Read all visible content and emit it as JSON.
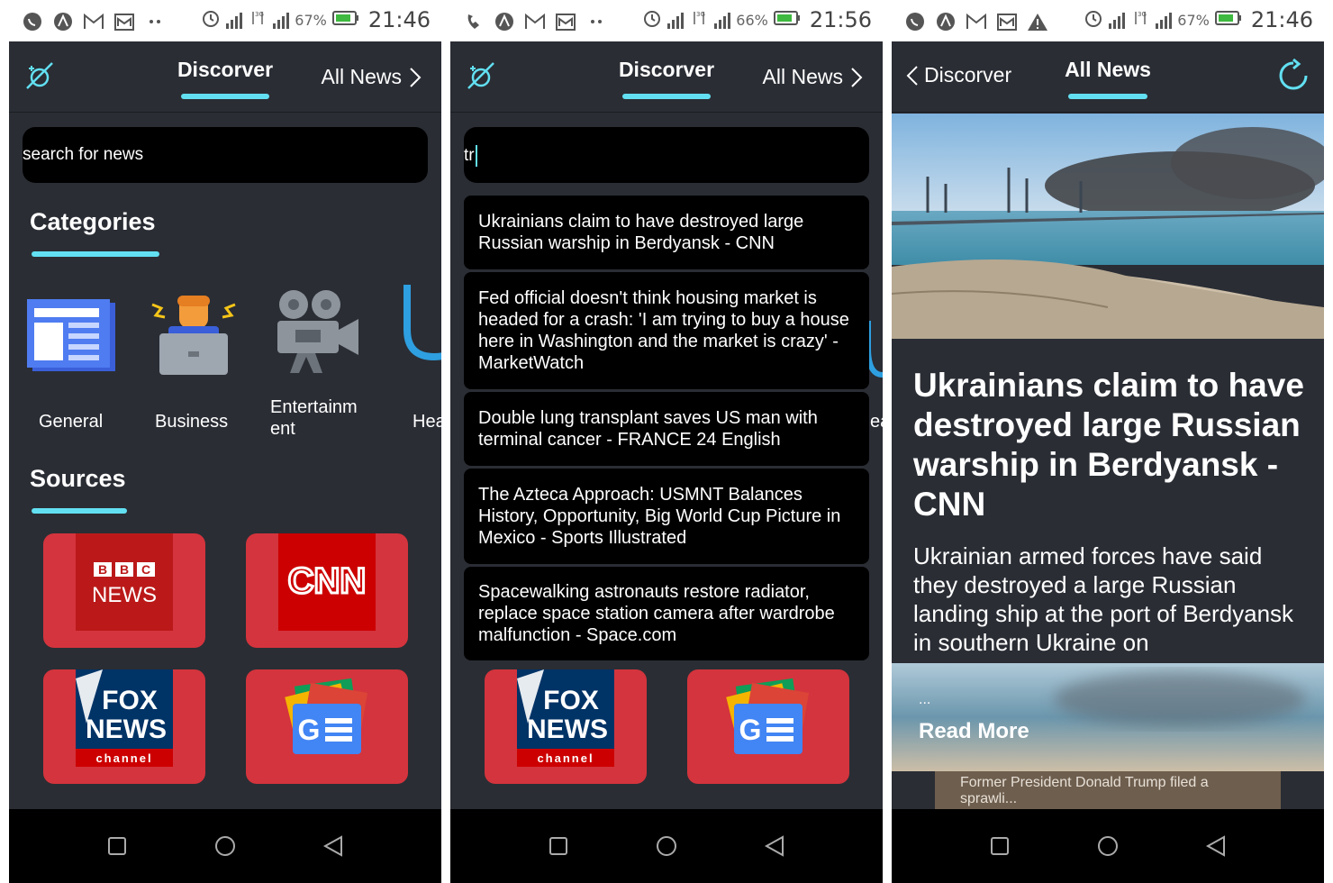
{
  "screens": [
    {
      "status": {
        "battery": "67%",
        "time": "21:46"
      },
      "topbar": {
        "title": "Discorver",
        "right_label": "All News"
      },
      "search": {
        "placeholder": "search for news"
      },
      "categories": {
        "title": "Categories",
        "items": [
          {
            "label": "General",
            "icon": "newspaper-icon"
          },
          {
            "label": "Business",
            "icon": "businessman-laptop-icon"
          },
          {
            "label": "Entertainm\nent",
            "icon": "movie-camera-icon"
          },
          {
            "label": "Hea",
            "icon": "stethoscope-icon"
          }
        ]
      },
      "sources": {
        "title": "Sources",
        "items": [
          {
            "name": "BBC NEWS",
            "line1": "BBC",
            "line2": "NEWS"
          },
          {
            "name": "CNN",
            "line1": "CNN"
          },
          {
            "name": "FOX NEWS channel",
            "line1": "FOX",
            "line2": "NEWS",
            "line3": "channel"
          },
          {
            "name": "Google News",
            "line1": "G"
          }
        ]
      }
    },
    {
      "status": {
        "battery": "66%",
        "time": "21:56"
      },
      "topbar": {
        "title": "Discorver",
        "right_label": "All News"
      },
      "search": {
        "value": "tr"
      },
      "suggestions": [
        "Ukrainians claim to have destroyed large Russian warship in Berdyansk - CNN",
        "Fed official doesn't think housing market is headed for a crash: 'I am trying to buy a house here in Washington and the market is crazy' - MarketWatch",
        "Double lung transplant saves US man with terminal cancer - FRANCE 24 English",
        "The Azteca Approach: USMNT Balances History, Opportunity, Big World Cup Picture in Mexico - Sports Illustrated",
        "Spacewalking astronauts restore radiator, replace space station camera after wardrobe malfunction - Space.com"
      ],
      "partial_category_label": "ea"
    },
    {
      "status": {
        "battery": "67%",
        "time": "21:46"
      },
      "topbar": {
        "back_label": "Discorver",
        "title": "All News"
      },
      "article": {
        "title": "Ukrainians claim to have destroyed large Russian warship in Berdyansk - CNN",
        "description": "Ukrainian armed forces have said they destroyed a large Russian landing ship at the port of Berdyansk in southern Ukraine on",
        "ellipsis": "...",
        "read_more": "Read More"
      },
      "next_card": {
        "text": "Former President Donald Trump filed a sprawli..."
      }
    }
  ],
  "colors": {
    "accent": "#62e0f2",
    "app_bg": "#2a2d34",
    "source_tile": "#d4343d"
  }
}
